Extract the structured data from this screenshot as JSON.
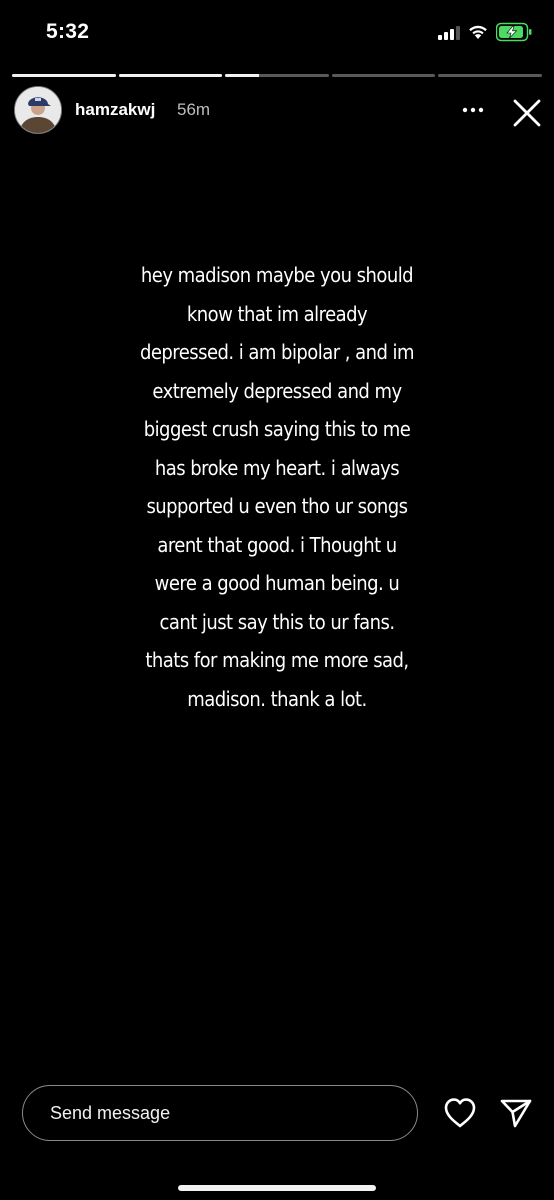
{
  "status_bar": {
    "time": "5:32",
    "battery_charging": true,
    "battery_color": "#4cd964"
  },
  "progress": {
    "segments": [
      1,
      1,
      0.33,
      0,
      0
    ],
    "active_color": "#f2f2f2",
    "inactive_color": "rgba(255,255,255,0.35)"
  },
  "header": {
    "username": "hamzakwj",
    "timestamp": "56m",
    "more_icon": "ellipsis-icon",
    "close_icon": "close-icon"
  },
  "story": {
    "text": "hey madison maybe you should\nknow that im already\ndepressed. i am bipolar , and im\nextremely depressed and my\nbiggest crush saying this to me\nhas broke my heart. i always\nsupported u even tho ur songs\narent that good.  i Thought u\nwere a good human being. u\ncant just say this to ur fans.\nthats for making me more sad,\nmadison. thank a lot.",
    "background": "#000000"
  },
  "footer": {
    "send_message_placeholder": "Send message",
    "like_icon": "heart-icon",
    "share_icon": "paper-plane-icon"
  }
}
